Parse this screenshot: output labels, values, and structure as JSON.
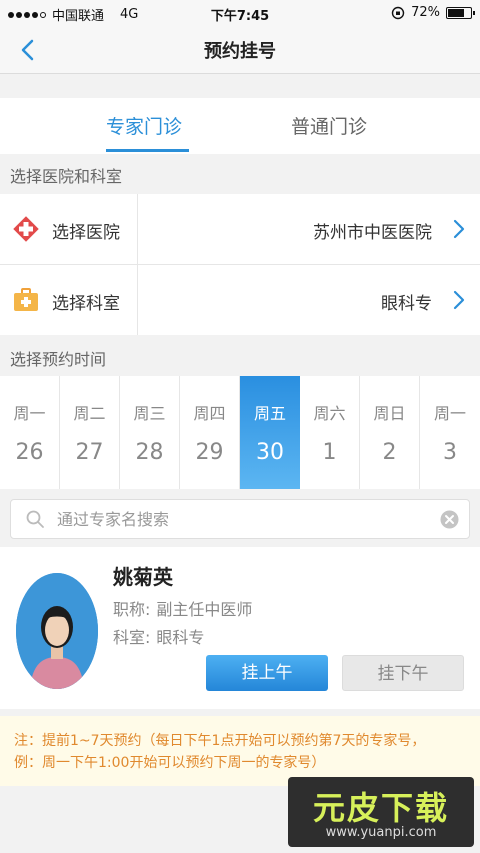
{
  "status_bar": {
    "carrier": "中国联通",
    "network": "4G",
    "time": "下午7:45",
    "battery": "72%",
    "battery_level": 0.72
  },
  "nav": {
    "title": "预约挂号"
  },
  "tabs": [
    {
      "label": "专家门诊",
      "active": true
    },
    {
      "label": "普通门诊",
      "active": false
    }
  ],
  "section_hospital": "选择医院和科室",
  "rows": {
    "hospital": {
      "label": "选择医院",
      "value": "苏州市中医医院"
    },
    "department": {
      "label": "选择科室",
      "value": "眼科专"
    }
  },
  "section_time": "选择预约时间",
  "days": [
    {
      "weekday": "周一",
      "date": "26"
    },
    {
      "weekday": "周二",
      "date": "27"
    },
    {
      "weekday": "周三",
      "date": "28"
    },
    {
      "weekday": "周四",
      "date": "29"
    },
    {
      "weekday": "周五",
      "date": "30",
      "selected": true
    },
    {
      "weekday": "周六",
      "date": "1"
    },
    {
      "weekday": "周日",
      "date": "2"
    },
    {
      "weekday": "周一",
      "date": "3"
    }
  ],
  "search": {
    "placeholder": "通过专家名搜索",
    "value": ""
  },
  "doctor": {
    "name": "姚菊英",
    "title_label": "职称:",
    "title_value": "副主任中医师",
    "dept_label": "科室:",
    "dept_value": "眼科专",
    "morning_button": "挂上午",
    "afternoon_button": "挂下午"
  },
  "note": {
    "line1": "注：提前1~7天预约（每日下午1点开始可以预约第7天的专家号，",
    "line2": "例：周一下午1:00开始可以预约下周一的专家号）"
  },
  "watermark": {
    "text": "元皮下载",
    "url": "www.yuanpi.com"
  },
  "colors": {
    "accent": "#2b8fd8",
    "note": "#e0892e"
  }
}
